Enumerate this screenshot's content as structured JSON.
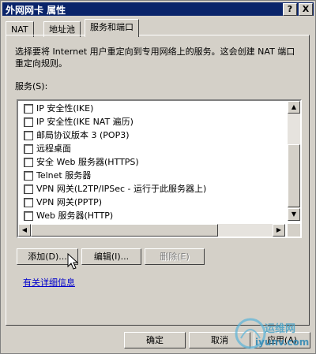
{
  "window": {
    "title": "外网网卡 属性",
    "help_button": "?",
    "close_button": "X"
  },
  "tabs": [
    {
      "label": "NAT"
    },
    {
      "label": "地址池"
    },
    {
      "label": "服务和端口",
      "active": true
    }
  ],
  "description": "选择要将 Internet 用户重定向到专用网络上的服务。这会创建 NAT 端口重定向规则。",
  "services_label": "服务(S):",
  "services": [
    {
      "label": "IP 安全性(IKE)",
      "checked": false
    },
    {
      "label": "IP 安全性(IKE NAT 遍历)",
      "checked": false
    },
    {
      "label": "邮局协议版本 3 (POP3)",
      "checked": false
    },
    {
      "label": "远程桌面",
      "checked": false
    },
    {
      "label": "安全 Web 服务器(HTTPS)",
      "checked": false
    },
    {
      "label": "Telnet 服务器",
      "checked": false
    },
    {
      "label": "VPN 网关(L2TP/IPSec - 运行于此服务器上)",
      "checked": false
    },
    {
      "label": "VPN 网关(PPTP)",
      "checked": false
    },
    {
      "label": "Web 服务器(HTTP)",
      "checked": false
    }
  ],
  "buttons": {
    "add": "添加(D)...",
    "edit": "编辑(I)...",
    "delete": "删除(E)"
  },
  "more_info_link": "有关详细信息",
  "footer": {
    "ok": "确定",
    "cancel": "取消",
    "apply": "应用(A)"
  },
  "watermark": {
    "line1": "运维网",
    "line2": "iyunv.com"
  },
  "colors": {
    "titlebar": "#0a246a",
    "face": "#d4d0c8",
    "link": "#0000cc"
  }
}
